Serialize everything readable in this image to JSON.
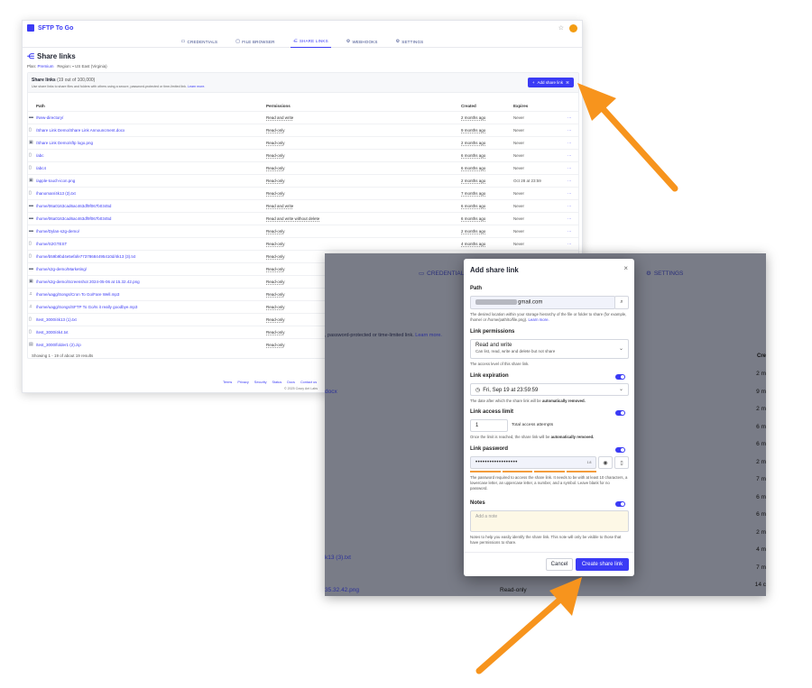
{
  "app": {
    "name": "SFTP To Go",
    "nav_tabs": [
      {
        "label": "CREDENTIALS",
        "icon": "id-card-icon"
      },
      {
        "label": "FILE BROWSER",
        "icon": "folder-icon"
      },
      {
        "label": "SHARE LINKS",
        "icon": "share-icon"
      },
      {
        "label": "WEBHOOKS",
        "icon": "webhook-icon"
      },
      {
        "label": "SETTINGS",
        "icon": "gear-icon"
      }
    ]
  },
  "page": {
    "title": "Share links",
    "plan_label": "Plan:",
    "plan_value": "Premium",
    "region_label": "Region:",
    "region_value": "US East (Virginia)"
  },
  "card": {
    "title": "Share links",
    "count": "(19 out of 100,000)",
    "desc": "Use share links to share files and folders with others using a secure, password-protected or time-limited link.",
    "learn_more": "Learn more.",
    "add_button": "Add share link",
    "columns": {
      "path": "Path",
      "permissions": "Permissions",
      "created": "Created",
      "expires": "Expires"
    },
    "rows": [
      {
        "path": "/New-directory/",
        "perm": "Read and write",
        "created": "2 months ago",
        "expires": "Never",
        "icon": "folder-icon"
      },
      {
        "path": "/Share Link Demo/Share Link Announcment.docx",
        "perm": "Read-only",
        "created": "9 months ago",
        "expires": "Never",
        "icon": "file-icon"
      },
      {
        "path": "/Share Link Demo/sftp logo.png",
        "perm": "Read-only",
        "created": "2 months ago",
        "expires": "Never",
        "icon": "image-icon"
      },
      {
        "path": "/abc",
        "perm": "Read-only",
        "created": "6 months ago",
        "expires": "Never",
        "icon": "file-icon"
      },
      {
        "path": "/abc4",
        "perm": "Read-only",
        "created": "6 months ago",
        "expires": "Never",
        "icon": "file-icon"
      },
      {
        "path": "/apple-touch-icon.png",
        "perm": "Read-only",
        "created": "2 months ago",
        "expires": "Oct 28 at 23:59",
        "icon": "image-icon"
      },
      {
        "path": "/hanoman/4k13 (3).txt",
        "perm": "Read-only",
        "created": "7 months ago",
        "expires": "Never",
        "icon": "file-icon"
      },
      {
        "path": "/home/06a0163cad6ac463df9f067b0345d",
        "perm": "Read and write",
        "created": "6 months ago",
        "expires": "Never",
        "icon": "folder-icon"
      },
      {
        "path": "/home/06a0163cad6ac463df9f067b0345d",
        "perm": "Read and write without delete",
        "created": "6 months ago",
        "expires": "Never",
        "icon": "folder-icon"
      },
      {
        "path": "/home/Dylan-s2g-demo/",
        "perm": "Read-only",
        "created": "2 months ago",
        "expires": "Never",
        "icon": "folder-icon"
      },
      {
        "path": "/home/S2GTEST",
        "perm": "Read-only",
        "created": "4 months ago",
        "expires": "Never",
        "icon": "file-icon"
      },
      {
        "path": "/home/b59b9bd4e5efafe77378684495410d/4k13 (3).txt",
        "perm": "Read-only",
        "created": "",
        "expires": "",
        "icon": "file-icon"
      },
      {
        "path": "/home/s2g-demo/Marketing/",
        "perm": "Read-only",
        "created": "",
        "expires": "",
        "icon": "folder-icon"
      },
      {
        "path": "/home/s2g-demo/Screenshot 2024-05-06 at 15.32.42.png",
        "perm": "Read-only",
        "created": "",
        "expires": "",
        "icon": "image-icon"
      },
      {
        "path": "/home/uagg/Songs/Cron To Go/Fare Well.mp3",
        "perm": "Read-only",
        "created": "",
        "expires": "",
        "icon": "music-icon"
      },
      {
        "path": "/home/uagg/Songs/SFTP To Go/Is it really goodbye.mp3",
        "perm": "Read-only",
        "created": "",
        "expires": "",
        "icon": "music-icon"
      },
      {
        "path": "/test_3000/4k13 (1).txt",
        "perm": "Read-only",
        "created": "",
        "expires": "",
        "icon": "file-icon"
      },
      {
        "path": "/test_3000/4k4.txt",
        "perm": "Read-only",
        "created": "",
        "expires": "",
        "icon": "file-icon"
      },
      {
        "path": "/test_3000/folder1 (2).zip",
        "perm": "Read-only",
        "created": "",
        "expires": "",
        "icon": "archive-icon"
      }
    ],
    "showing": "Showing 1 - 19 of about 19 results"
  },
  "footer": {
    "links": [
      "Terms",
      "Privacy",
      "Security",
      "Status",
      "Docs",
      "Contact us"
    ],
    "copyright": "© 2025 Crazy Ant Labs"
  },
  "overlay": {
    "credentials": "CREDENTIALS",
    "settings": "SETTINGS",
    "subtext": ", password-protected or time-limited link.",
    "subtext_link": "Learn more.",
    "created_col": "Cre",
    "docx": "docx",
    "txt": "k13 (3).txt",
    "png": "35.32.42.png",
    "read_only": "Read-only",
    "right_vals": [
      "2 m",
      "9 m",
      "2 m",
      "6 m",
      "6 m",
      "2 m",
      "7 m",
      "6 m",
      "6 m",
      "2 m",
      "4 m",
      "7 m",
      "14 c",
      "2 m"
    ]
  },
  "modal": {
    "title": "Add share link",
    "path_label": "Path",
    "path_value_suffix": "gmail.com",
    "path_help": "The desired location within your storage hierarchy of the file or folder to share (for example, /home/ or /home/path/to/file.png).",
    "path_help_link": "Learn more.",
    "perm_label": "Link permissions",
    "perm_value": "Read and write",
    "perm_desc": "Can list, read, write and delete but not share",
    "perm_help": "The access level of this share link.",
    "exp_label": "Link expiration",
    "exp_value": "Fri, Sep 19 at 23:59:59",
    "exp_help_pre": "The date after which the share link will be",
    "exp_help_bold": "automatically removed.",
    "limit_label": "Link access limit",
    "limit_value": "1",
    "limit_suffix": "Total access attempts",
    "limit_help_pre": "Once the limit is reached, the share link will be",
    "limit_help_bold": "automatically removed.",
    "pw_label": "Link password",
    "pw_value": "••••••••••••••••••",
    "pw_count": "18",
    "pw_help": "The password required to access the share link. It needs to be with at least 10 characters, a lowercase letter, an uppercase letter, a number, and a symbol. Leave blank for no password.",
    "notes_label": "Notes",
    "notes_placeholder": "Add a note",
    "notes_help": "Notes to help you easily identify the share link. This note will only be visible to those that have permissions to share.",
    "cancel": "Cancel",
    "create": "Create share link"
  },
  "colors": {
    "accent": "#3b3bf5",
    "arrow": "#f7941d",
    "overlay": "#797c87"
  }
}
